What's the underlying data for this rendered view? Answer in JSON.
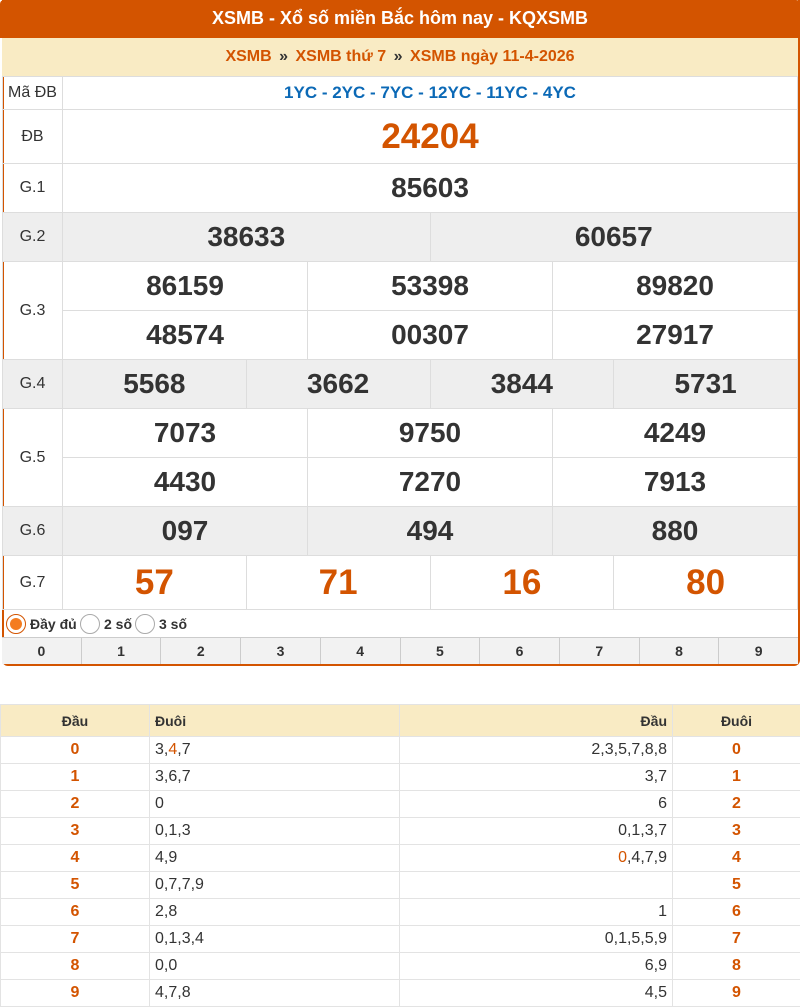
{
  "header": {
    "title": "XSMB - Xổ số miền Bắc hôm nay - KQXSMB"
  },
  "breadcrumb": {
    "items": [
      "XSMB",
      "XSMB thứ 7",
      "XSMB ngày 11-4-2026"
    ],
    "separator": "»"
  },
  "results": {
    "ma_db_label": "Mã ĐB",
    "ma_db_value": "1YC - 2YC - 7YC - 12YC - 11YC - 4YC",
    "db_label": "ĐB",
    "db": "24204",
    "g1_label": "G.1",
    "g1": "85603",
    "g2_label": "G.2",
    "g2": [
      "38633",
      "60657"
    ],
    "g3_label": "G.3",
    "g3": [
      "86159",
      "53398",
      "89820",
      "48574",
      "00307",
      "27917"
    ],
    "g4_label": "G.4",
    "g4": [
      "5568",
      "3662",
      "3844",
      "5731"
    ],
    "g5_label": "G.5",
    "g5": [
      "7073",
      "9750",
      "4249",
      "4430",
      "7270",
      "7913"
    ],
    "g6_label": "G.6",
    "g6": [
      "097",
      "494",
      "880"
    ],
    "g7_label": "G.7",
    "g7": [
      "57",
      "71",
      "16",
      "80"
    ]
  },
  "options": {
    "items": [
      "Đầy đủ",
      "2 số",
      "3 số"
    ],
    "selected": "Đầy đủ"
  },
  "digit_filter": [
    "0",
    "1",
    "2",
    "3",
    "4",
    "5",
    "6",
    "7",
    "8",
    "9"
  ],
  "loto_table": {
    "headers": [
      "Đầu",
      "Đuôi",
      "Đầu",
      "Đuôi"
    ],
    "rows": [
      {
        "dau": "0",
        "duoi_pre": "3,",
        "duoi_hl": "4",
        "duoi_post": ",7",
        "dau2_hl": "",
        "dau2_rest": "2,3,5,7,8,8",
        "duoi2": "0"
      },
      {
        "dau": "1",
        "duoi_pre": "3,6,7",
        "duoi_hl": "",
        "duoi_post": "",
        "dau2_hl": "",
        "dau2_rest": "3,7",
        "duoi2": "1"
      },
      {
        "dau": "2",
        "duoi_pre": "0",
        "duoi_hl": "",
        "duoi_post": "",
        "dau2_hl": "",
        "dau2_rest": "6",
        "duoi2": "2"
      },
      {
        "dau": "3",
        "duoi_pre": "0,1,3",
        "duoi_hl": "",
        "duoi_post": "",
        "dau2_hl": "",
        "dau2_rest": "0,1,3,7",
        "duoi2": "3"
      },
      {
        "dau": "4",
        "duoi_pre": "4,9",
        "duoi_hl": "",
        "duoi_post": "",
        "dau2_hl": "0",
        "dau2_rest": ",4,7,9",
        "duoi2": "4"
      },
      {
        "dau": "5",
        "duoi_pre": "0,7,7,9",
        "duoi_hl": "",
        "duoi_post": "",
        "dau2_hl": "",
        "dau2_rest": "",
        "duoi2": "5"
      },
      {
        "dau": "6",
        "duoi_pre": "2,8",
        "duoi_hl": "",
        "duoi_post": "",
        "dau2_hl": "",
        "dau2_rest": "1",
        "duoi2": "6"
      },
      {
        "dau": "7",
        "duoi_pre": "0,1,3,4",
        "duoi_hl": "",
        "duoi_post": "",
        "dau2_hl": "",
        "dau2_rest": "0,1,5,5,9",
        "duoi2": "7"
      },
      {
        "dau": "8",
        "duoi_pre": "0,0",
        "duoi_hl": "",
        "duoi_post": "",
        "dau2_hl": "",
        "dau2_rest": "6,9",
        "duoi2": "8"
      },
      {
        "dau": "9",
        "duoi_pre": "4,7,8",
        "duoi_hl": "",
        "duoi_post": "",
        "dau2_hl": "",
        "dau2_rest": "4,5",
        "duoi2": "9"
      }
    ]
  },
  "colors": {
    "accent": "#d35400",
    "header_bg": "#d35400",
    "crumb_bg": "#f9ebc4",
    "code_blue": "#0b69b6"
  }
}
